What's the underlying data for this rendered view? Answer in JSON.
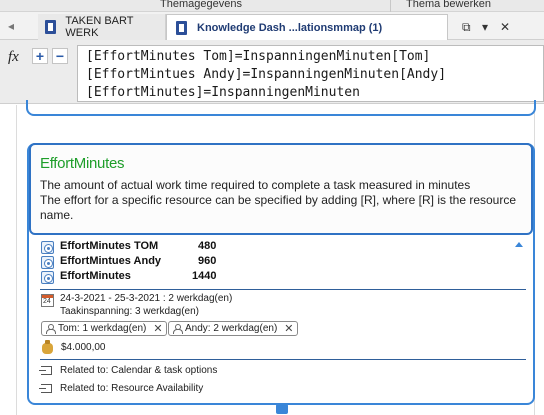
{
  "ribbon": {
    "group_left": "Themagegevens",
    "group_right": "Thema bewerken"
  },
  "tabs": [
    {
      "label": "TAKEN BART WERK",
      "active": false
    },
    {
      "label": "Knowledge Dash ...lationsmmap (1)",
      "active": true
    }
  ],
  "tab_controls": {
    "restore": "⧉",
    "dropdown": "▾",
    "close": "✕"
  },
  "formula_bar": {
    "fx_label": "fx",
    "add_label": "+",
    "remove_label": "−",
    "lines": [
      "[EffortMinutes Tom]=InspanningenMinuten[Tom]",
      "[EffortMintues Andy]=InspanningenMinuten[Andy]",
      "[EffortMinutes]=InspanningenMinuten"
    ]
  },
  "card": {
    "title": "EffortMinutes",
    "description_1": "The amount of actual work time required to complete a task measured in minutes",
    "description_2": "The effort for a specific resource can be specified by adding [R], where [R] is the resource name.",
    "metrics": [
      {
        "name": "EffortMinutes TOM",
        "value": "480"
      },
      {
        "name": "EffortMintues Andy",
        "value": "960"
      },
      {
        "name": "EffortMinutes",
        "value": "1440"
      }
    ],
    "date_range": "24-3-2021 - 25-3-2021 : 2 werkdag(en)",
    "effort": "Taakinspanning: 3 werkdag(en)",
    "calendar_day": "24",
    "resources": [
      {
        "label": "Tom: 1 werkdag(en)"
      },
      {
        "label": "Andy: 2 werkdag(en)"
      }
    ],
    "cost": "$4.000,00",
    "relations": [
      {
        "label": "Related to: Calendar & task options"
      },
      {
        "label": "Related to: Resource Availability"
      }
    ]
  },
  "colors": {
    "accent_blue": "#3a86d8",
    "title_green": "#1e9e2a",
    "tab_active_text": "#1f3b73"
  },
  "icons": {
    "tab_doc": "document-icon",
    "metric": "property-gear-icon",
    "calendar": "calendar-icon",
    "person": "person-icon",
    "money": "money-bag-icon",
    "relation": "link-arrow-icon"
  }
}
